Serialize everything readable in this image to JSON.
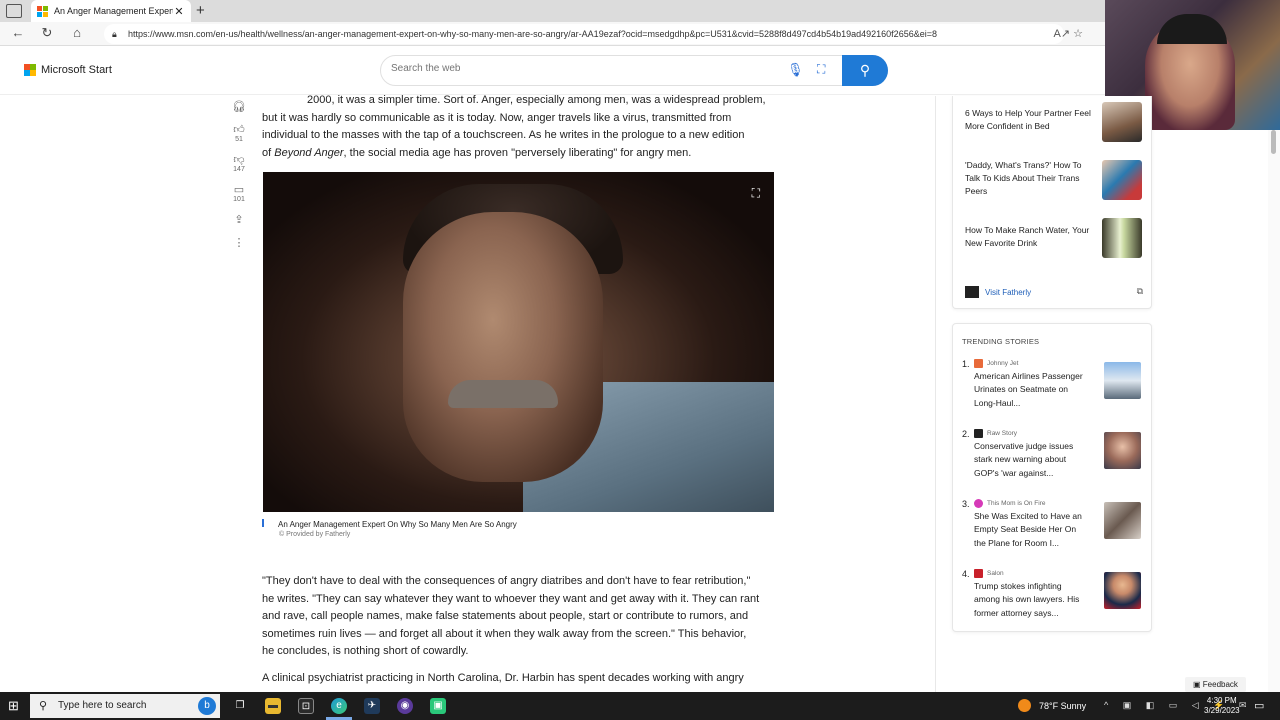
{
  "browser": {
    "tab_title": "An Anger Management Expert O",
    "tab_close": "✕",
    "new_tab": "+",
    "url": "https://www.msn.com/en-us/health/wellness/an-anger-management-expert-on-why-so-many-men-are-so-angry/ar-AA19ezaf?ocid=msedgdhp&pc=U531&cvid=5288f8d497cd4b54b19ad492160f2656&ei=8"
  },
  "header": {
    "logo_text": "Microsoft Start",
    "search_placeholder": "Search the web"
  },
  "rail": {
    "like_count": "51",
    "dislike_count": "147",
    "comment_count": "101"
  },
  "article": {
    "para1_line1": "2000, it was a simpler time. Sort of. Anger, especially among men, was a widespread problem,",
    "para1_line2": "but it was hardly so communicable as it is today. Now, anger travels like a virus, transmitted from",
    "para1_line3": "individual to the masses with the tap of a touchscreen. As he writes in the prologue to a new edition",
    "para1_line4_pre": "of ",
    "para1_book": "Beyond Anger",
    "para1_line4_post": ", the social media age has proven \"perversely liberating\" for angry men.",
    "image_caption": "An Anger Management Expert On Why So Many Men Are So Angry",
    "image_credit": "© Provided by Fatherly",
    "para2_line1": "\"They don't have to deal with the consequences of angry diatribes and don't have to fear retribution,\"",
    "para2_line2": "he writes. \"They can say whatever they want to whoever they want and get away with it. They can rant",
    "para2_line3": "and rave, call people names, make false statements about people, start or contribute to rumors, and",
    "para2_line4": "sometimes ruin lives — and forget all about it when they walk away from the screen.\" This behavior,",
    "para2_line5": "he concludes, is nothing short of cowardly.",
    "para3_line1": "A clinical psychiatrist practicing in North Carolina, Dr. Harbin has spent decades working with angry"
  },
  "sidebar": {
    "promos": [
      {
        "title": "6 Ways to Help Your Partner Feel More Confident in Bed"
      },
      {
        "title": "'Daddy, What's Trans?' How To Talk To Kids About Their Trans Peers"
      },
      {
        "title": "How To Make Ranch Water, Your New Favorite Drink"
      }
    ],
    "visit_label": "Visit Fatherly",
    "trending_title": "TRENDING STORIES",
    "trending": [
      {
        "num": "1.",
        "source": "Johnny Jet",
        "headline": "American Airlines Passenger Urinates on Seatmate on Long-Haul...",
        "logo_color": "#e86a3a"
      },
      {
        "num": "2.",
        "source": "Raw Story",
        "headline": "Conservative judge issues stark new warning about GOP's 'war against...",
        "logo_color": "#222222"
      },
      {
        "num": "3.",
        "source": "This Mom is On Fire",
        "headline": "She Was Excited to Have an Empty Seat Beside Her On the Plane for Room I...",
        "logo_color": "#d63ab8"
      },
      {
        "num": "4.",
        "source": "Salon",
        "headline": "Trump stokes infighting among his own lawyers. His former attorney says...",
        "logo_color": "#c8202a"
      }
    ]
  },
  "feedback_label": "Feedback",
  "taskbar": {
    "search_text": "Type here to search",
    "weather": "78°F  Sunny",
    "time": "4:30 PM",
    "date": "3/29/2023"
  }
}
